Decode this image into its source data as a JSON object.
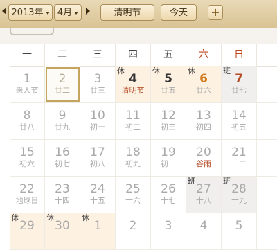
{
  "toolbar": {
    "year": "2013年",
    "month": "4月",
    "holiday_button": "清明节",
    "today_button": "今天",
    "add_button": "+"
  },
  "weekdays": [
    "一",
    "二",
    "三",
    "四",
    "五",
    "六",
    "日"
  ],
  "weeks": [
    [
      {
        "num": "1",
        "lunar": "愚人节",
        "badge": "",
        "style": "other"
      },
      {
        "num": "2",
        "lunar": "廿二",
        "badge": "",
        "style": "today"
      },
      {
        "num": "3",
        "lunar": "廿三",
        "badge": "",
        "style": "other"
      },
      {
        "num": "4",
        "lunar": "清明节",
        "badge": "休",
        "style": "holiday-festival"
      },
      {
        "num": "5",
        "lunar": "廿五",
        "badge": "休",
        "style": "holiday"
      },
      {
        "num": "6",
        "lunar": "廿六",
        "badge": "休",
        "style": "holiday-orange"
      },
      {
        "num": "7",
        "lunar": "廿七",
        "badge": "班",
        "style": "work"
      }
    ],
    [
      {
        "num": "8",
        "lunar": "廿八",
        "badge": "",
        "style": "other"
      },
      {
        "num": "9",
        "lunar": "廿九",
        "badge": "",
        "style": "other"
      },
      {
        "num": "10",
        "lunar": "初一",
        "badge": "",
        "style": "other"
      },
      {
        "num": "11",
        "lunar": "初二",
        "badge": "",
        "style": "other"
      },
      {
        "num": "12",
        "lunar": "初三",
        "badge": "",
        "style": "other"
      },
      {
        "num": "13",
        "lunar": "初四",
        "badge": "",
        "style": "other"
      },
      {
        "num": "14",
        "lunar": "初五",
        "badge": "",
        "style": "other"
      }
    ],
    [
      {
        "num": "15",
        "lunar": "初六",
        "badge": "",
        "style": "other"
      },
      {
        "num": "16",
        "lunar": "初七",
        "badge": "",
        "style": "other"
      },
      {
        "num": "17",
        "lunar": "初八",
        "badge": "",
        "style": "other"
      },
      {
        "num": "18",
        "lunar": "初九",
        "badge": "",
        "style": "other"
      },
      {
        "num": "19",
        "lunar": "初十",
        "badge": "",
        "style": "other"
      },
      {
        "num": "20",
        "lunar": "谷雨",
        "badge": "",
        "style": "festival"
      },
      {
        "num": "21",
        "lunar": "十二",
        "badge": "",
        "style": "other"
      }
    ],
    [
      {
        "num": "22",
        "lunar": "地球日",
        "badge": "",
        "style": "other"
      },
      {
        "num": "23",
        "lunar": "十四",
        "badge": "",
        "style": "other"
      },
      {
        "num": "24",
        "lunar": "十五",
        "badge": "",
        "style": "other"
      },
      {
        "num": "25",
        "lunar": "十六",
        "badge": "",
        "style": "other"
      },
      {
        "num": "26",
        "lunar": "十七",
        "badge": "",
        "style": "other"
      },
      {
        "num": "27",
        "lunar": "十八",
        "badge": "班",
        "style": "workbg"
      },
      {
        "num": "28",
        "lunar": "十九",
        "badge": "班",
        "style": "workbg"
      }
    ],
    [
      {
        "num": "29",
        "lunar": "",
        "badge": "休",
        "style": "holiday"
      },
      {
        "num": "30",
        "lunar": "",
        "badge": "休",
        "style": "holiday"
      },
      {
        "num": "1",
        "lunar": "",
        "badge": "休",
        "style": "holiday"
      },
      {
        "num": "2",
        "lunar": "",
        "badge": "",
        "style": "other"
      },
      {
        "num": "3",
        "lunar": "",
        "badge": "",
        "style": "other"
      },
      {
        "num": "4",
        "lunar": "",
        "badge": "",
        "style": "other"
      },
      {
        "num": "5",
        "lunar": "",
        "badge": "",
        "style": "other"
      }
    ]
  ]
}
